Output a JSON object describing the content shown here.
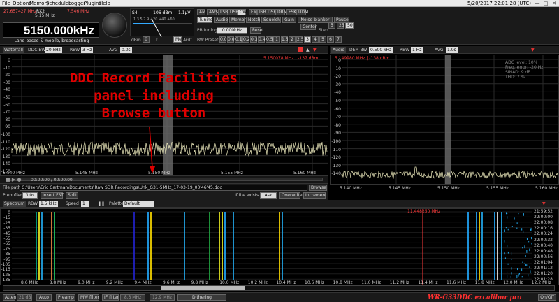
{
  "menu": {
    "items": [
      "File",
      "Options",
      "Memory",
      "Scheduler",
      "Logger",
      "Plugins",
      "Help"
    ],
    "datetime": "5/20/2017 22:01:28 (UTC)"
  },
  "receiver": {
    "freq_small": [
      "27.657427 MHz",
      "5.15 MHz",
      "7.546 MHz"
    ],
    "rx_label": "RX2",
    "freq": "5150.000kHz",
    "freq_desc": "Land-based & mobile, broadcasting",
    "smeter_s": "S4",
    "smeter_dbm": "-106 dBm",
    "smeter_uv": "1.1µV",
    "smeter_scale": "1 3 5 7 9 +20 +40 +60",
    "dbm_label": "dBm",
    "dbm_value": "0",
    "agc_label": "AGC",
    "agc_mode": "Med",
    "speaker": "♪",
    "modes": [
      "AM",
      "AMS",
      "LSB",
      "USB",
      "CW",
      "FM",
      "ISB",
      "DSB",
      "DRM",
      "FSK",
      "UDM"
    ],
    "funcs": [
      "Tuning",
      "Audio",
      "Memory",
      "Notch",
      "Squelch",
      "Gain",
      "Noise blanker",
      "Pause"
    ],
    "pb_label": "PB tuning",
    "pb_value": "0.000kHz",
    "reset_label": "Reset",
    "bw_label": "BW Presets",
    "bw": [
      "0.02",
      "0.05",
      "0.1",
      "0.2",
      "0.3",
      "0.4",
      "0.5",
      "1",
      "1.5",
      "2",
      "2.5",
      "3",
      "4",
      "5",
      "6",
      "7"
    ],
    "center_label": "Center",
    "step_label": "Step",
    "steps": [
      "5",
      "25",
      "50"
    ]
  },
  "waterfall_bar": {
    "tab": "Waterfall",
    "ddc_label": "DDC BW",
    "ddc_value": "20 kHz",
    "rbw_label": "RBW",
    "rbw_value": "3 Hz",
    "avg_label": "AVG",
    "avg_value": "0.0s"
  },
  "audio_bar": {
    "tab": "Audio",
    "dem_label": "DEM BW",
    "dem_value": "0.500 kHz",
    "rbw_label": "RBW",
    "rbw_value": "1 Hz",
    "avg_label": "AVG",
    "avg_value": "1.0s"
  },
  "left_spectrum": {
    "marker": "5.150078 MHz | -137 dBm",
    "y_labels": [
      "0",
      "-10",
      "-20",
      "-30",
      "-40",
      "-50",
      "-60",
      "-70",
      "-80",
      "-90",
      "-100",
      "-110",
      "-120",
      "-130",
      "-140",
      "-150"
    ],
    "x_labels": [
      "5.140 MHz",
      "5.145 MHz",
      "5.150 MHz",
      "5.155 MHz",
      "5.160 MHz"
    ]
  },
  "right_spectrum": {
    "marker": "5.149980 MHz | -138 dBm",
    "info": [
      "ADC level: 10%",
      "Freq. error: -20 Hz",
      "SINAD: 9 dB",
      "THD: 7 %"
    ],
    "y_labels": [
      "0",
      "-10",
      "-20",
      "-30",
      "-40",
      "-50",
      "-60",
      "-70",
      "-80",
      "-90",
      "-100",
      "-110",
      "-120",
      "-130",
      "-140"
    ],
    "x_labels": [
      "5.140 MHz",
      "5.145 MHz",
      "5.150 MHz",
      "5.155 MHz",
      "5.160 MHz"
    ]
  },
  "annotation": {
    "line1": "DDC Record Facilities",
    "line2": "panel including",
    "line3": "Browse button"
  },
  "record": {
    "time": "00:00:00 / 00:00:00",
    "file_label": "File path",
    "file_path": "C:\\Users\\Eric Cartman\\Documents\\Raw SDR Recordings\\Unk_G31-5MHz_17-03-19_00'46'45.ddc",
    "browse": "Browse",
    "prebuffer_label": "Prebuffer",
    "prebuffer_value": "3.0s",
    "insert_label": "Insert FST",
    "split_label": "Split",
    "exists_label": "If file exists",
    "ask": "Ask",
    "overwrite": "Overwrite",
    "increment": "Increment"
  },
  "spectrum_bar": {
    "tab": "Spectrum",
    "rbw_label": "RBW",
    "rbw_value": "1.5 kHz",
    "speed_label": "Speed",
    "speed_value": "1",
    "palette_label": "Palette",
    "palette_value": "Default"
  },
  "wideband": {
    "marker": "11.448250 MHz",
    "y_labels": [
      "0",
      "-15",
      "-25",
      "-35",
      "-45",
      "-55",
      "-65",
      "-75",
      "-85",
      "-95",
      "-105",
      "-115",
      "-125",
      "-135"
    ],
    "x_labels": [
      "8.6 MHz",
      "8.8 MHz",
      "9.0 MHz",
      "9.2 MHz",
      "9.4 MHz",
      "9.6 MHz",
      "9.8 MHz",
      "10.0 MHz",
      "10.2 MHz",
      "10.4 MHz",
      "10.6 MHz",
      "10.8 MHz",
      "11.0 MHz",
      "11.2 MHz",
      "11.4 MHz",
      "11.6 MHz",
      "11.8 MHz",
      "12.0 MHz",
      "12.2 MHz"
    ],
    "times": [
      "21:59:52",
      "22:00:00",
      "22:00:08",
      "22:00:16",
      "22:00:24",
      "22:00:32",
      "22:00:40",
      "22:00:48",
      "22:00:56",
      "22:01:04",
      "22:01:12",
      "22:01:20",
      "22:01:28"
    ]
  },
  "bottom": {
    "atten_label": "Atten",
    "atten_value": "21 dB",
    "auto": "Auto",
    "preamp": "Preamp",
    "mw_filter": "MW filter",
    "if_filter": "IF filter",
    "if_value": "8.3 MHz",
    "if_value2": "12.9 MHz",
    "dithering": "Dithering",
    "onoff": "On/Off",
    "brand": "WR-G33DDC excalibur pro"
  },
  "colors": {
    "trace": "#f1eec0",
    "annotation": "#e00000",
    "marker": "#ff3b3b",
    "freq_text": "#ffffff",
    "brand": "#ff3030"
  }
}
